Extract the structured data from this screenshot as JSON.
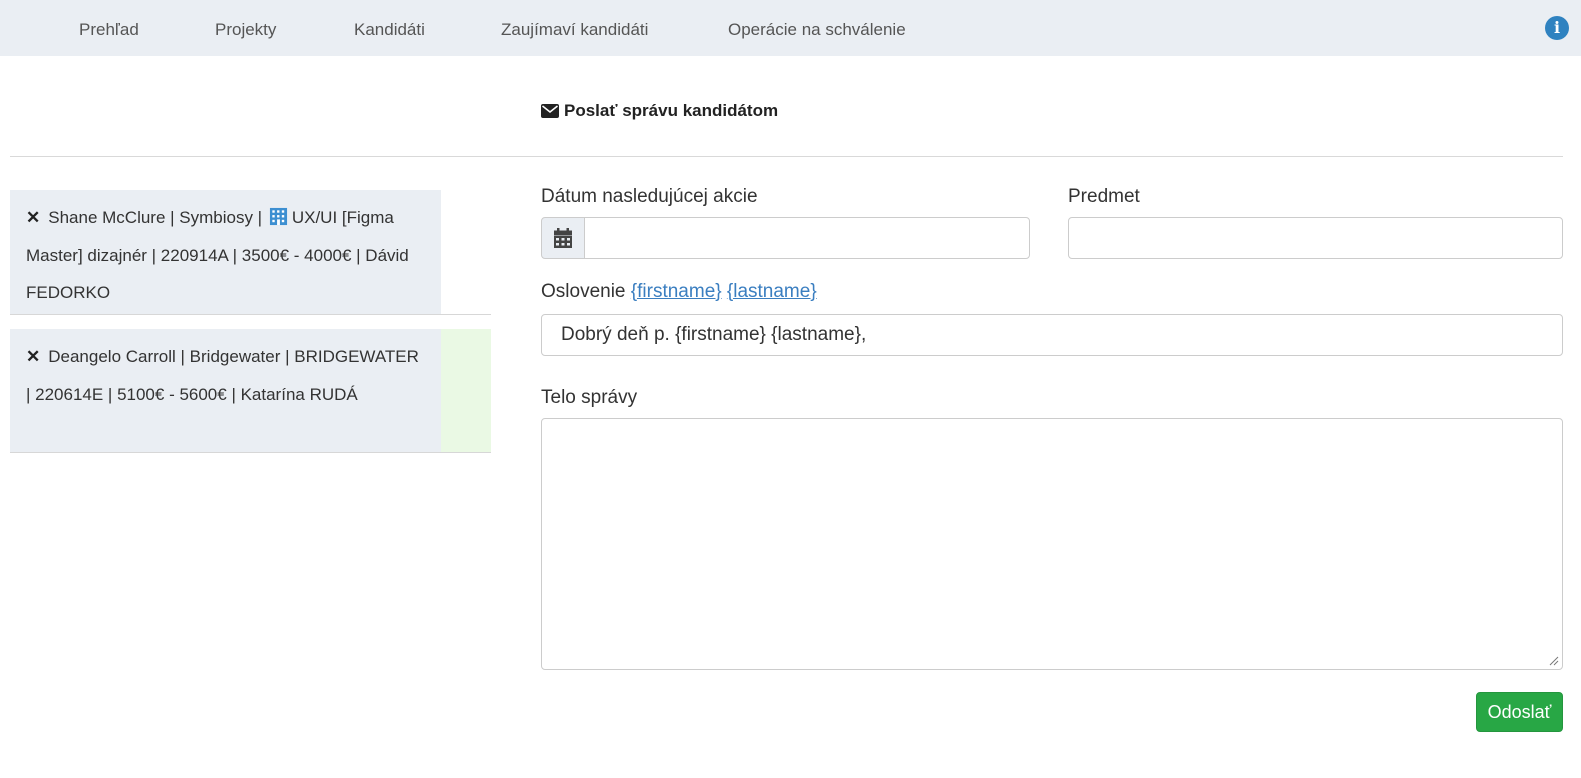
{
  "nav": {
    "items": [
      {
        "label": "Prehľad"
      },
      {
        "label": "Projekty"
      },
      {
        "label": "Kandidáti"
      },
      {
        "label": "Zaujímaví kandidáti"
      },
      {
        "label": "Operácie na schválenie"
      }
    ],
    "info_icon": "info-circle-icon",
    "info_glyph": "i"
  },
  "page": {
    "title": "Poslať správu kandidátom",
    "title_icon": "envelope-icon"
  },
  "candidates": [
    {
      "remove_icon": "close-icon",
      "remove_glyph": "✕",
      "text_before_icon": "Shane McClure | Symbiosy |",
      "company_icon": "building-icon",
      "text_after_icon": "UX/UI [Figma Master] dizajnér | 220914A | 3500€ - 4000€ | Dávid FEDORKO",
      "side_color": "#ffffff"
    },
    {
      "remove_icon": "close-icon",
      "remove_glyph": "✕",
      "text": "Deangelo Carroll | Bridgewater | BRIDGEWATER | 220614E | 5100€ - 5600€ | Katarína RUDÁ",
      "side_color": "#eaf9e4"
    }
  ],
  "form": {
    "date_label": "Dátum nasledujúcej akcie",
    "date_value": "",
    "calendar_icon": "calendar-icon",
    "subject_label": "Predmet",
    "subject_value": "",
    "greeting_label": "Oslovenie",
    "greeting_token_firstname": "{firstname}",
    "greeting_token_lastname": "{lastname}",
    "greeting_value": "Dobrý deň p. {firstname} {lastname},",
    "body_label": "Telo správy",
    "body_value": "",
    "submit_label": "Odoslať"
  },
  "colors": {
    "nav_bg": "#eaeef3",
    "link": "#3a7ec0",
    "submit": "#28a745",
    "info": "#2f82c0"
  }
}
